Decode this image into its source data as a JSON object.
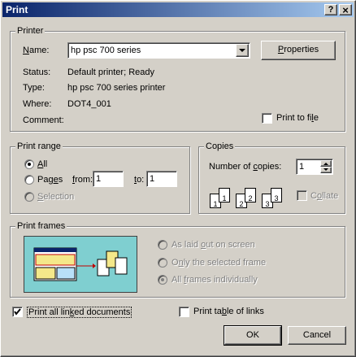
{
  "window": {
    "title": "Print",
    "help_label": "?",
    "close_label": "×"
  },
  "printer": {
    "group_label": "Printer",
    "name_label": "Name:",
    "name_value": "hp psc 700 series",
    "properties_label": "Properties",
    "status_label": "Status:",
    "status_value": "Default printer; Ready",
    "type_label": "Type:",
    "type_value": "hp psc 700 series printer",
    "where_label": "Where:",
    "where_value": "DOT4_001",
    "comment_label": "Comment:",
    "print_to_file_label": "Print to file",
    "print_to_file_checked": false
  },
  "print_range": {
    "group_label": "Print range",
    "all_label": "All",
    "pages_label": "Pages",
    "from_label": "from:",
    "from_value": "1",
    "to_label": "to:",
    "to_value": "1",
    "selection_label": "Selection",
    "selected": "all"
  },
  "copies": {
    "group_label": "Copies",
    "number_label": "Number of copies:",
    "number_value": "1",
    "collate_label": "Collate",
    "collate_checked": false,
    "page_numbers": [
      "1",
      "1",
      "2",
      "2",
      "3",
      "3"
    ]
  },
  "print_frames": {
    "group_label": "Print frames",
    "option_as_laid_out": "As laid out on screen",
    "option_selected_frame": "Only the selected frame",
    "option_all_frames": "All frames individually",
    "selected": "all_frames"
  },
  "options": {
    "print_linked_label": "Print all linked documents",
    "print_linked_checked": true,
    "print_table_links_label": "Print table of links",
    "print_table_links_checked": false
  },
  "buttons": {
    "ok": "OK",
    "cancel": "Cancel"
  },
  "colors": {
    "titlebar_start": "#0a246a",
    "titlebar_end": "#a6caf0",
    "face": "#d4d0c8",
    "preview_bg": "#7fcfd0"
  }
}
